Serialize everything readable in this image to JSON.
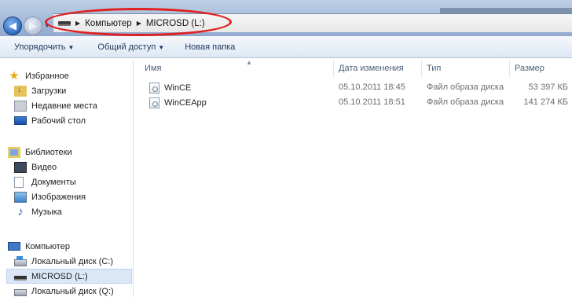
{
  "address_bar": {
    "breadcrumb": [
      "Компьютер",
      "MICROSD (L:)"
    ],
    "highlight_color": "#e01f1f"
  },
  "toolbar": {
    "organize_label": "Упорядочить",
    "share_label": "Общий доступ",
    "new_folder_label": "Новая папка"
  },
  "sidebar": {
    "favorites": {
      "header": "Избранное",
      "items": [
        {
          "label": "Загрузки",
          "icon": "downloads-folder-icon"
        },
        {
          "label": "Недавние места",
          "icon": "recent-places-icon"
        },
        {
          "label": "Рабочий стол",
          "icon": "desktop-icon"
        }
      ]
    },
    "libraries": {
      "header": "Библиотеки",
      "items": [
        {
          "label": "Видео",
          "icon": "video-icon"
        },
        {
          "label": "Документы",
          "icon": "documents-icon"
        },
        {
          "label": "Изображения",
          "icon": "pictures-icon"
        },
        {
          "label": "Музыка",
          "icon": "music-icon"
        }
      ]
    },
    "computer": {
      "header": "Компьютер",
      "items": [
        {
          "label": "Локальный диск (C:)",
          "icon": "system-disk-icon",
          "selected": false
        },
        {
          "label": "MICROSD (L:)",
          "icon": "removable-drive-icon",
          "selected": true
        },
        {
          "label": "Локальный диск (Q:)",
          "icon": "disk-icon",
          "selected": false
        }
      ]
    }
  },
  "file_list": {
    "columns": {
      "name": "Имя",
      "date": "Дата изменения",
      "type": "Тип",
      "size": "Размер"
    },
    "rows": [
      {
        "name": "WinCE",
        "date": "05.10.2011 18:45",
        "type": "Файл образа диска",
        "size": "53 397 КБ",
        "icon": "disk-image-icon"
      },
      {
        "name": "WinCEApp",
        "date": "05.10.2011 18:51",
        "type": "Файл образа диска",
        "size": "141 274 КБ",
        "icon": "disk-image-icon"
      }
    ]
  }
}
